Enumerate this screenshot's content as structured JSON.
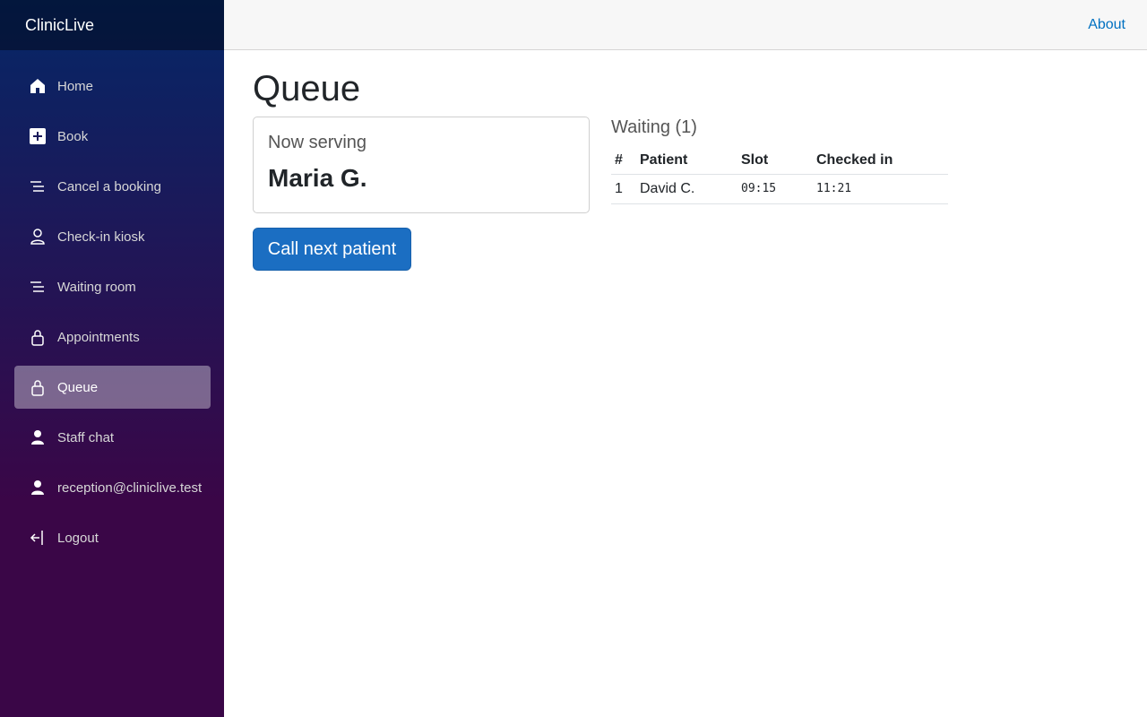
{
  "app": {
    "brand": "ClinicLive"
  },
  "topbar": {
    "about_label": "About"
  },
  "sidebar": {
    "items": [
      {
        "label": "Home",
        "icon": "home-icon"
      },
      {
        "label": "Book",
        "icon": "plus-square-icon"
      },
      {
        "label": "Cancel a booking",
        "icon": "list-icon"
      },
      {
        "label": "Check-in kiosk",
        "icon": "person-outline-icon"
      },
      {
        "label": "Waiting room",
        "icon": "list-icon"
      },
      {
        "label": "Appointments",
        "icon": "lock-icon"
      },
      {
        "label": "Queue",
        "icon": "lock-icon",
        "active": true
      },
      {
        "label": "Staff chat",
        "icon": "person-icon"
      },
      {
        "label": "reception@cliniclive.test",
        "icon": "person-icon"
      },
      {
        "label": "Logout",
        "icon": "logout-icon"
      }
    ]
  },
  "main": {
    "title": "Queue",
    "now_serving": {
      "label": "Now serving",
      "name": "Maria G."
    },
    "call_next_label": "Call next patient",
    "waiting": {
      "title": "Waiting (1)",
      "columns": [
        "#",
        "Patient",
        "Slot",
        "Checked in"
      ],
      "rows": [
        {
          "num": "1",
          "patient": "David C.",
          "slot": "09:15",
          "checked_in": "11:21"
        }
      ]
    }
  },
  "colors": {
    "accent": "#1b6ec2",
    "link": "#0071c1",
    "sidebar_top": "#052767",
    "sidebar_bottom": "#3a0647"
  }
}
